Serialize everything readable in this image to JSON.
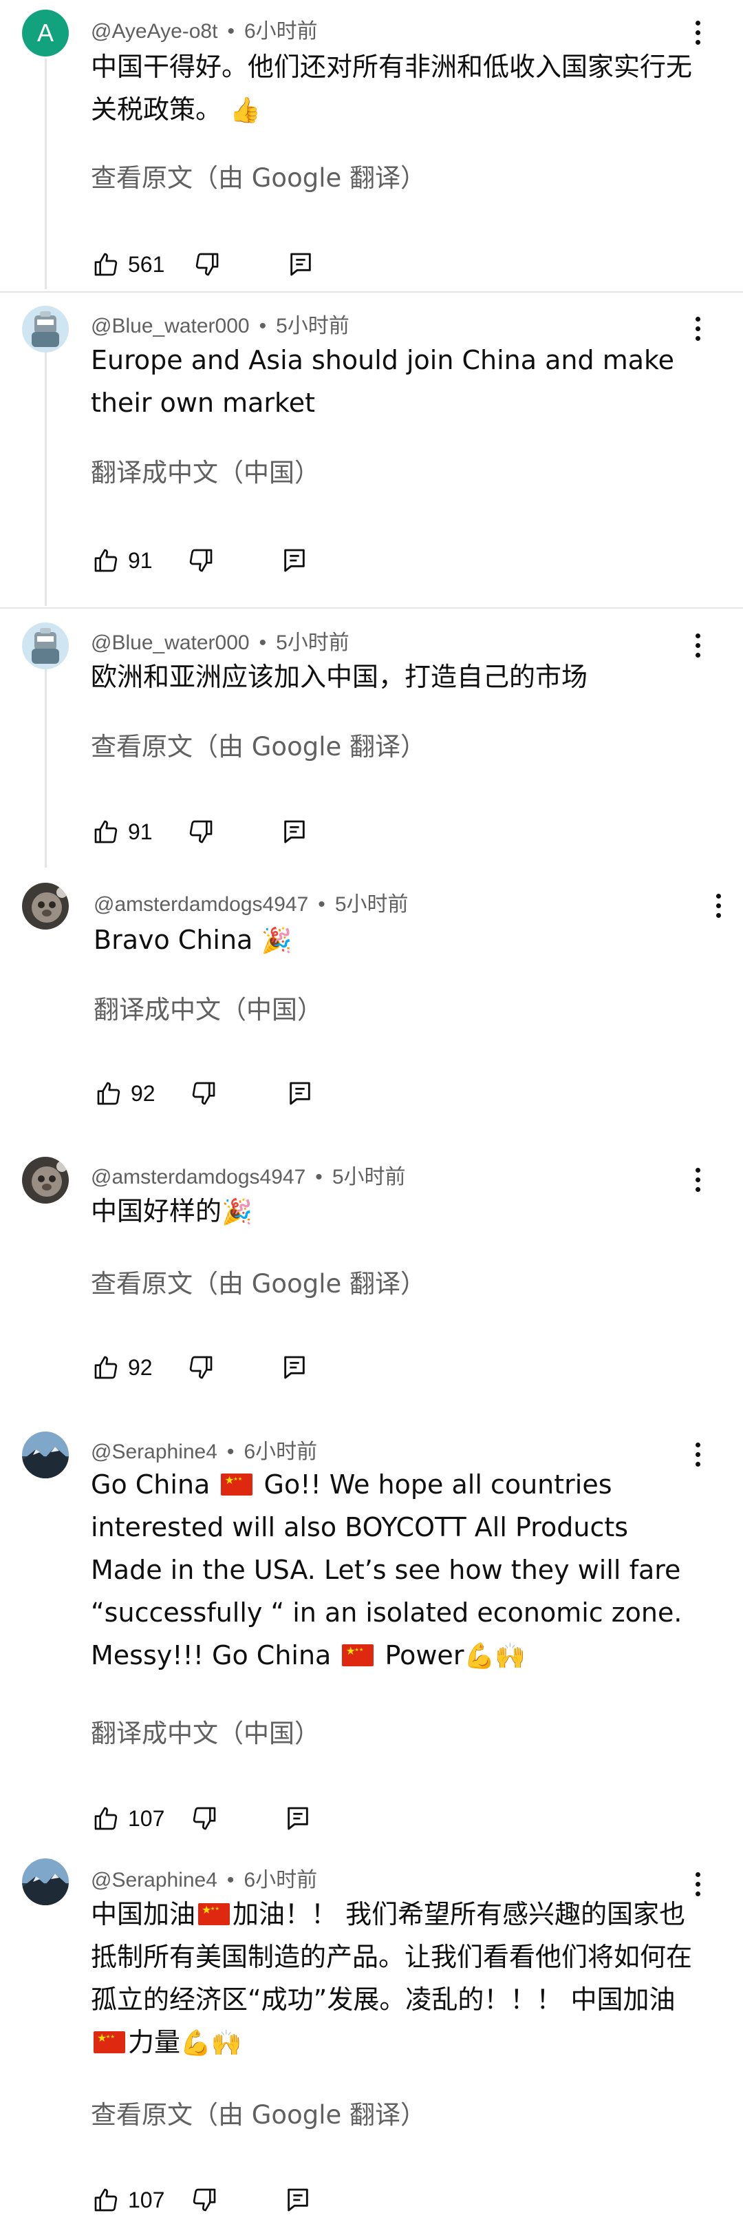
{
  "comments": [
    {
      "avatar_letter": "A",
      "author": "@AyeAye-o8t",
      "time": "6小时前",
      "text": "中国干得好。他们还对所有非洲和低收入国家实行无关税政策。",
      "emoji": "👍",
      "translate_label": "查看原文（由 Google 翻译）",
      "likes": "561"
    },
    {
      "author": "@Blue_water000",
      "time": "5小时前",
      "text": "Europe and Asia should join China and make their own market",
      "translate_label": "翻译成中文（中国）",
      "likes": "91"
    },
    {
      "author": "@Blue_water000",
      "time": "5小时前",
      "text": "欧洲和亚洲应该加入中国，打造自己的市场",
      "translate_label": "查看原文（由 Google 翻译）",
      "likes": "91"
    },
    {
      "author": "@amsterdamdogs4947",
      "time": "5小时前",
      "text": "Bravo China",
      "emoji": "🎉",
      "translate_label": "翻译成中文（中国）",
      "likes": "92"
    },
    {
      "author": "@amsterdamdogs4947",
      "time": "5小时前",
      "text": "中国好样的",
      "emoji": "🎉",
      "translate_label": "查看原文（由 Google 翻译）",
      "likes": "92"
    },
    {
      "author": "@Seraphine4",
      "time": "6小时前",
      "text_parts": [
        "Go China",
        "Go!! We hope all countries interested will also BOYCOTT All Products Made in the USA. Let’s see how they will fare “successfully “ in an isolated economic zone. Messy!!! Go China",
        "Power"
      ],
      "emoji": "💪🙌",
      "translate_label": "翻译成中文（中国）",
      "likes": "107"
    },
    {
      "author": "@Seraphine4",
      "time": "6小时前",
      "text_parts": [
        "中国加油",
        "加油！！ 我们希望所有感兴趣的国家也抵制所有美国制造的产品。让我们看看他们将如何在孤立的经济区“成功”发展。凌乱的！！！ 中国加油",
        "力量"
      ],
      "emoji": "💪🙌",
      "translate_label": "查看原文（由 Google 翻译）",
      "likes": "107"
    }
  ],
  "colors": {
    "avatar_a": "#12a37e",
    "meta": "#606060",
    "divider": "#e5e5e5"
  },
  "icons": [
    "thumb-up-icon",
    "thumb-down-icon",
    "reply-icon",
    "more-vert-icon"
  ]
}
